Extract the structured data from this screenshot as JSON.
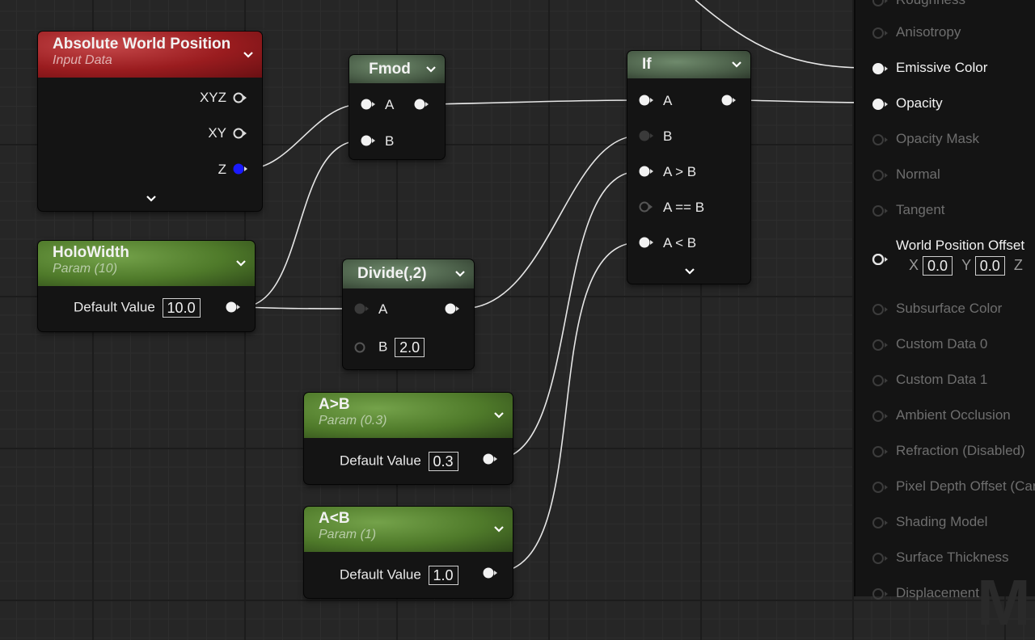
{
  "nodes": {
    "abs": {
      "title": "Absolute World Position",
      "subtitle": "Input Data",
      "pins": [
        "XYZ",
        "XY",
        "Z"
      ]
    },
    "fmod": {
      "title": "Fmod",
      "pins": [
        "A",
        "B"
      ]
    },
    "holo": {
      "title": "HoloWidth",
      "subtitle": "Param (10)",
      "field_label": "Default Value",
      "field_value": "10.0"
    },
    "divide": {
      "title": "Divide(,2)",
      "pins": [
        "A",
        "B"
      ],
      "b_value": "2.0"
    },
    "agtb": {
      "title": "A>B",
      "subtitle": "Param (0.3)",
      "field_label": "Default Value",
      "field_value": "0.3"
    },
    "altb": {
      "title": "A<B",
      "subtitle": "Param (1)",
      "field_label": "Default Value",
      "field_value": "1.0"
    },
    "ifn": {
      "title": "If",
      "pins": [
        "A",
        "B",
        "A > B",
        "A == B",
        "A < B"
      ]
    }
  },
  "panel": {
    "items": [
      {
        "label": "Roughness",
        "active": false
      },
      {
        "label": "Anisotropy",
        "active": false
      },
      {
        "label": "Emissive Color",
        "active": true
      },
      {
        "label": "Opacity",
        "active": true
      },
      {
        "label": "Opacity Mask",
        "active": false
      },
      {
        "label": "Normal",
        "active": false
      },
      {
        "label": "Tangent",
        "active": false
      },
      {
        "label": "World Position Offset",
        "active": true
      },
      {
        "label": "Subsurface Color",
        "active": false
      },
      {
        "label": "Custom Data 0",
        "active": false
      },
      {
        "label": "Custom Data 1",
        "active": false
      },
      {
        "label": "Ambient Occlusion",
        "active": false
      },
      {
        "label": "Refraction (Disabled)",
        "active": false
      },
      {
        "label": "Pixel Depth Offset (Car",
        "active": false
      },
      {
        "label": "Shading Model",
        "active": false
      },
      {
        "label": "Surface Thickness",
        "active": false
      },
      {
        "label": "Displacement",
        "active": false
      }
    ],
    "wpo": {
      "x_label": "X",
      "x": "0.0",
      "y_label": "Y",
      "y": "0.0",
      "z_label": "Z"
    },
    "watermark": "M"
  },
  "colors": {
    "pin_white": "#f2f2f2",
    "pin_blue": "#1a1aff",
    "pin_dim": "#3a3a3a",
    "header_red": "#9a1c1f",
    "header_green": "#4f7a2a",
    "header_grey": "#4a5e48"
  }
}
